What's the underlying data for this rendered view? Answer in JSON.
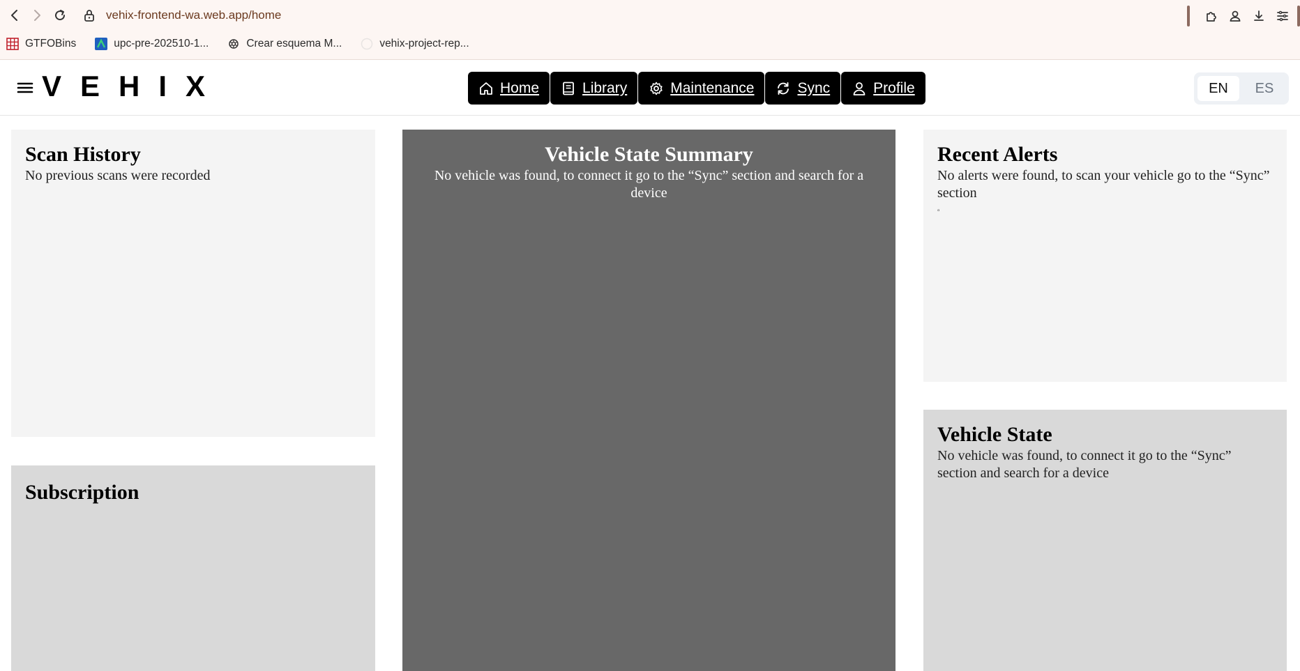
{
  "browser": {
    "url": "vehix-frontend-wa.web.app/home",
    "bookmarks": [
      {
        "label": "GTFOBins",
        "icon": "grid-icon"
      },
      {
        "label": "upc-pre-202510-1...",
        "icon": "upc-icon"
      },
      {
        "label": "Crear esquema M...",
        "icon": "openai-icon"
      },
      {
        "label": "vehix-project-rep...",
        "icon": "github-icon"
      }
    ]
  },
  "header": {
    "brand": "VEHIX",
    "nav": [
      {
        "label": "Home",
        "icon": "home-icon"
      },
      {
        "label": "Library",
        "icon": "book-icon"
      },
      {
        "label": "Maintenance",
        "icon": "gear-icon"
      },
      {
        "label": "Sync",
        "icon": "sync-icon"
      },
      {
        "label": "Profile",
        "icon": "user-icon"
      }
    ],
    "lang": {
      "en": "EN",
      "es": "ES",
      "active": "EN"
    }
  },
  "cards": {
    "scan_history": {
      "title": "Scan History",
      "text": "No previous scans were recorded"
    },
    "subscription": {
      "title": "Subscription"
    },
    "summary": {
      "title": "Vehicle State Summary",
      "text": "No vehicle was found, to connect it go to the “Sync” section and search for a device"
    },
    "alerts": {
      "title": "Recent Alerts",
      "text": "No alerts were found, to scan your vehicle go to the “Sync” section",
      "marker": "▫"
    },
    "vehicle_state": {
      "title": "Vehicle State",
      "text": "No vehicle was found, to connect it go to the “Sync” section and search for a device"
    }
  },
  "colors": {
    "nav_bg": "#000000",
    "summary_bg": "#686868",
    "card_light": "#f4f4f4",
    "card_gray": "#d9d9d9"
  }
}
